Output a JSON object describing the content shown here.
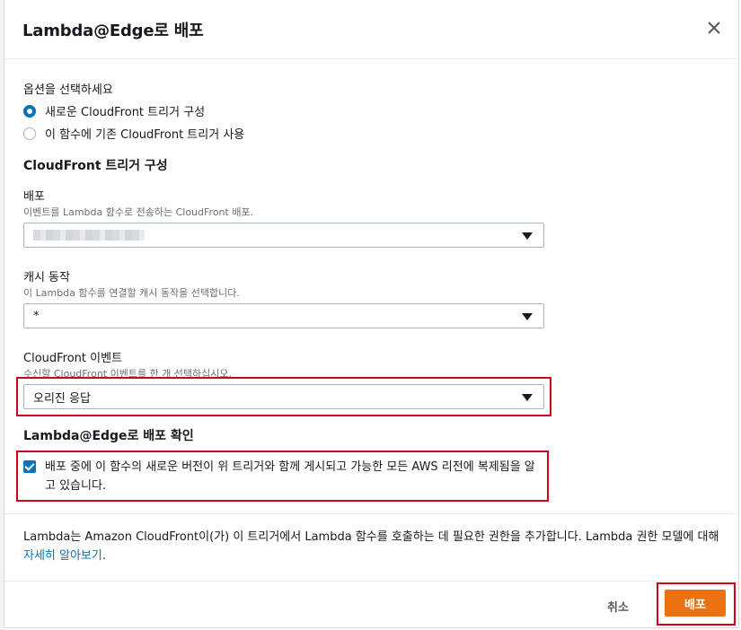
{
  "dialog": {
    "title": "Lambda@Edge로 배포"
  },
  "options": {
    "label": "옵션을 선택하세요",
    "items": [
      {
        "label": "새로운 CloudFront 트리거 구성",
        "selected": true
      },
      {
        "label": "이 함수에 기존 CloudFront 트리거 사용",
        "selected": false
      }
    ]
  },
  "trigger_config": {
    "heading": "CloudFront 트리거 구성",
    "distribution": {
      "label": "배포",
      "description": "이벤트를 Lambda 함수로 전송하는 CloudFront 배포."
    },
    "cache_behavior": {
      "label": "캐시 동작",
      "description": "이 Lambda 함수를 연결할 캐시 동작을 선택합니다.",
      "value": "*"
    },
    "event": {
      "label": "CloudFront 이벤트",
      "description": "수신할 CloudFront 이벤트를 한 개 선택하십시오.",
      "value": "오리진 응답"
    }
  },
  "confirm": {
    "heading": "Lambda@Edge로 배포 확인",
    "text": "배포 중에 이 함수의 새로운 버전이 위 트리거와 함께 게시되고 가능한 모든 AWS 리전에 복제됨을 알고 있습니다.",
    "checked": true
  },
  "footer": {
    "text": "Lambda는 Amazon CloudFront이(가) 이 트리거에서 Lambda 함수를 호출하는 데 필요한 권한을 추가합니다. Lambda 권한 모델에 대해",
    "link": "자세히 알아보기",
    "link_suffix": "."
  },
  "actions": {
    "cancel": "취소",
    "deploy": "배포"
  },
  "colors": {
    "accent": "#0073bb",
    "primary_button": "#ec7211",
    "highlight": "#d0021b"
  }
}
